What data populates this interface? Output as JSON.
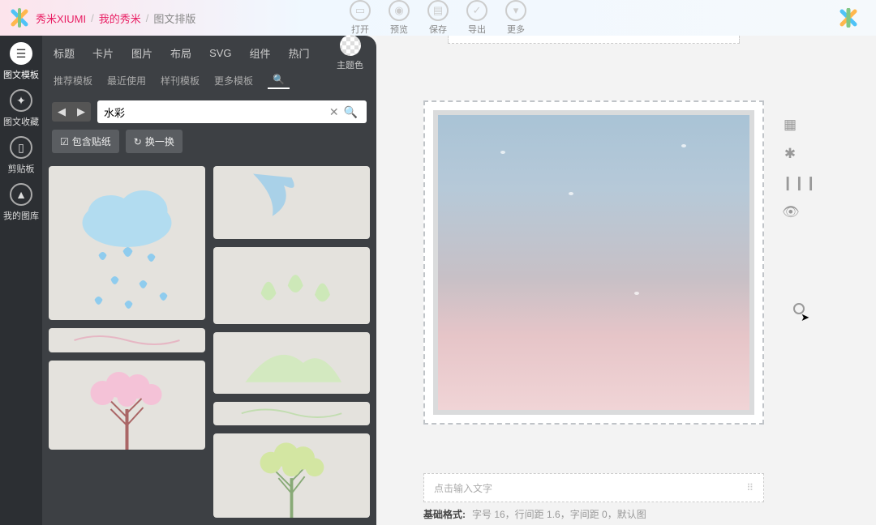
{
  "breadcrumb": {
    "brand": "秀米XIUMI",
    "mine": "我的秀米",
    "current": "图文排版"
  },
  "topbar": {
    "open": "打开",
    "preview": "预览",
    "save": "保存",
    "export": "导出",
    "more": "更多"
  },
  "leftrail": {
    "templates": "图文模板",
    "favorites": "图文收藏",
    "clipboard": "剪贴板",
    "mylib": "我的图库"
  },
  "panel": {
    "tabs1": {
      "title": "标题",
      "card": "卡片",
      "image": "图片",
      "layout": "布局",
      "svg": "SVG",
      "component": "组件",
      "hot": "热门"
    },
    "theme_label": "主题色",
    "tabs2": {
      "recommend": "推荐模板",
      "recent": "最近使用",
      "sample": "样刊模板",
      "more": "更多模板"
    },
    "search": {
      "value": "水彩",
      "placeholder": ""
    },
    "chip_sticker": "包含贴纸",
    "chip_refresh": "换一换"
  },
  "canvas": {
    "text_prompt": "点击输入文字",
    "footer_label": "基础格式:",
    "footer_detail": "字号 16，行间距 1.6，字间距 0，默认图"
  }
}
